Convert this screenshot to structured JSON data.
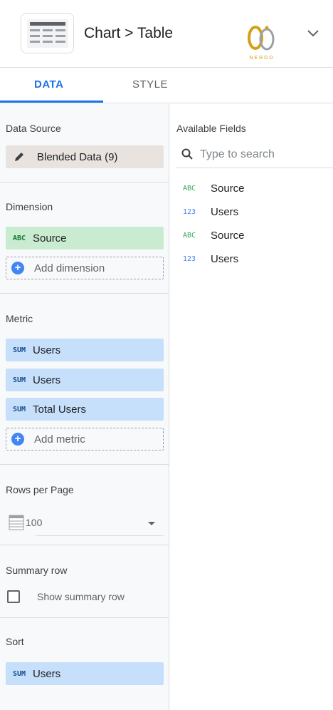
{
  "header": {
    "breadcrumb": "Chart > Table",
    "logo_text": "NERDO",
    "colors": {
      "accent": "#1a73e8",
      "logo_gold": "#d4a017"
    }
  },
  "tabs": [
    {
      "label": "DATA",
      "active": true
    },
    {
      "label": "STYLE",
      "active": false
    }
  ],
  "left_panel": {
    "data_source": {
      "title": "Data Source",
      "value": "Blended Data (9)",
      "icon": "pencil-icon"
    },
    "dimension": {
      "title": "Dimension",
      "items": [
        {
          "type": "ABC",
          "label": "Source"
        }
      ],
      "add_label": "Add dimension"
    },
    "metric": {
      "title": "Metric",
      "items": [
        {
          "type": "SUM",
          "label": "Users"
        },
        {
          "type": "SUM",
          "label": "Users"
        },
        {
          "type": "SUM",
          "label": "Total Users"
        }
      ],
      "add_label": "Add metric"
    },
    "rows_per_page": {
      "title": "Rows per Page",
      "value": "100"
    },
    "summary_row": {
      "title": "Summary row",
      "checkbox_label": "Show summary row",
      "checked": false
    },
    "sort": {
      "title": "Sort",
      "items": [
        {
          "type": "SUM",
          "label": "Users"
        }
      ]
    }
  },
  "right_panel": {
    "title": "Available Fields",
    "search_placeholder": "Type to search",
    "fields": [
      {
        "type": "ABC",
        "name": "Source"
      },
      {
        "type": "123",
        "name": "Users"
      },
      {
        "type": "ABC",
        "name": "Source"
      },
      {
        "type": "123",
        "name": "Users"
      }
    ]
  }
}
